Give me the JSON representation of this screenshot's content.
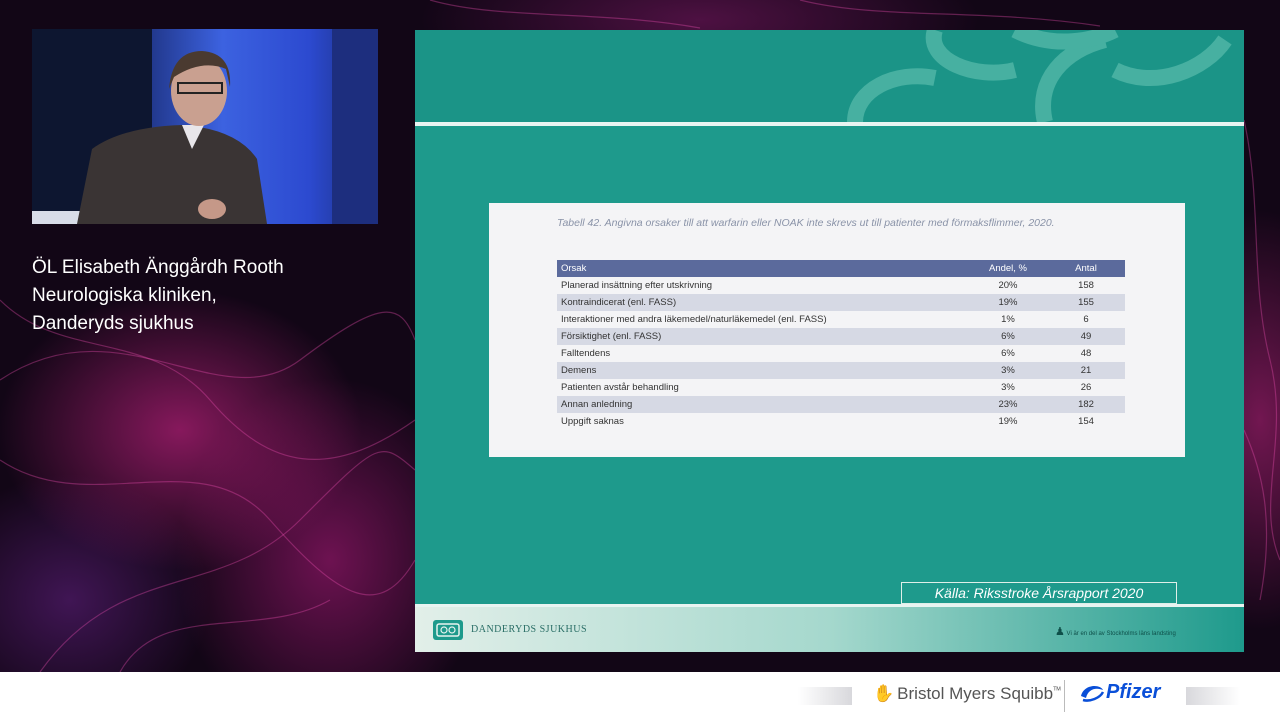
{
  "speaker": {
    "line1": "ÖL Elisabeth Änggårdh Rooth",
    "line2": "Neurologiska kliniken,",
    "line3": "Danderyds sjukhus"
  },
  "slide": {
    "caption": "Tabell 42. Angivna orsaker till att warfarin eller NOAK inte skrevs ut till patienter med förmaksflimmer, 2020.",
    "headers": [
      "Orsak",
      "Andel, %",
      "Antal"
    ],
    "rows": [
      [
        "Planerad insättning efter utskrivning",
        "20%",
        "158"
      ],
      [
        "Kontraindicerat (enl. FASS)",
        "19%",
        "155"
      ],
      [
        "Interaktioner med andra läkemedel/naturläkemedel (enl. FASS)",
        "1%",
        "6"
      ],
      [
        "Försiktighet (enl. FASS)",
        "6%",
        "49"
      ],
      [
        "Falltendens",
        "6%",
        "48"
      ],
      [
        "Demens",
        "3%",
        "21"
      ],
      [
        "Patienten avstår behandling",
        "3%",
        "26"
      ],
      [
        "Annan anledning",
        "23%",
        "182"
      ],
      [
        "Uppgift saknas",
        "19%",
        "154"
      ]
    ],
    "source": "Källa: Riksstroke Årsrapport 2020",
    "footer_logo": "DANDERYDS SJUKHUS",
    "footer_right": "Vi är en del av Stockholms läns landsting"
  },
  "sponsors": {
    "bms": "Bristol Myers Squibb",
    "bms_mark": "ᵀᴹ",
    "pfizer": "Pfizer"
  },
  "colors": {
    "slide_teal": "#1e9a8c",
    "table_header": "#5b6a9c",
    "pfizer_blue": "#0a4fd8",
    "bms_magenta": "#be2bbb"
  }
}
